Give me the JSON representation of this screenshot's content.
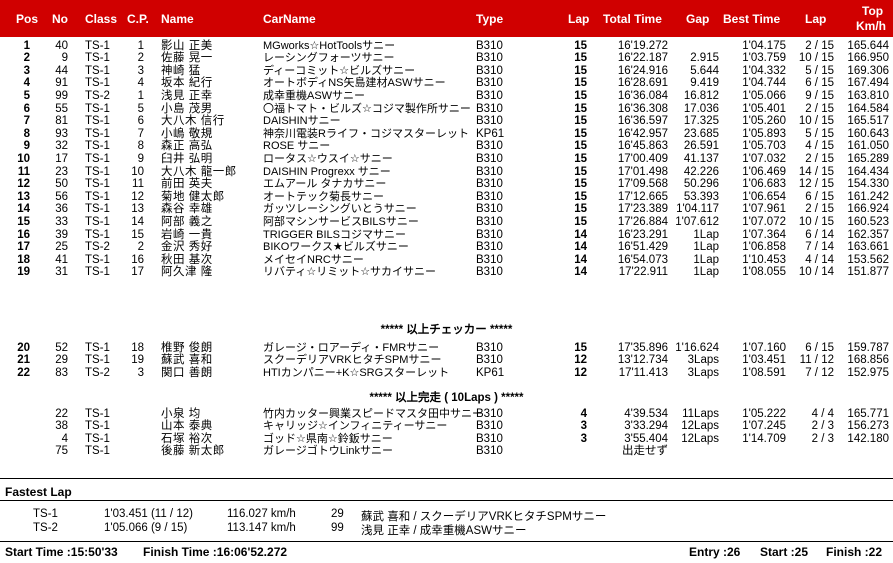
{
  "headers": {
    "pos": "Pos",
    "no": "No",
    "class": "Class",
    "cp": "C.P.",
    "name": "Name",
    "carname": "CarName",
    "type": "Type",
    "lap": "Lap",
    "total": "Total Time",
    "gap": "Gap",
    "best": "Best Time",
    "lap_b": "Lap",
    "top_l1": "Top",
    "top_l2": "Km/h"
  },
  "group1": [
    {
      "pos": "1",
      "no": "40",
      "cls": "TS-1",
      "cp": "1",
      "name": "影山 正美",
      "car": "MGworks☆HotToolsサニー",
      "type": "B310",
      "lap": "15",
      "total": "16'19.272",
      "gap": "",
      "best": "1'04.175",
      "bestlap": "2 / 15",
      "top": "165.644"
    },
    {
      "pos": "2",
      "no": "9",
      "cls": "TS-1",
      "cp": "2",
      "name": "佐藤 晃一",
      "car": "レーシングフォーツサニー",
      "type": "B310",
      "lap": "15",
      "total": "16'22.187",
      "gap": "2.915",
      "best": "1'03.759",
      "bestlap": "10 / 15",
      "top": "166.950"
    },
    {
      "pos": "3",
      "no": "44",
      "cls": "TS-1",
      "cp": "3",
      "name": "神崎 猛",
      "car": "ディーコミット☆ビルズサニー",
      "type": "B310",
      "lap": "15",
      "total": "16'24.916",
      "gap": "5.644",
      "best": "1'04.332",
      "bestlap": "5 / 15",
      "top": "169.306"
    },
    {
      "pos": "4",
      "no": "91",
      "cls": "TS-1",
      "cp": "4",
      "name": "坂本 紀行",
      "car": "オートボディNS矢島建材ASWサニー",
      "type": "B310",
      "lap": "15",
      "total": "16'28.691",
      "gap": "9.419",
      "best": "1'04.744",
      "bestlap": "6 / 15",
      "top": "167.494"
    },
    {
      "pos": "5",
      "no": "99",
      "cls": "TS-2",
      "cp": "1",
      "name": "浅見 正幸",
      "car": "成幸重機ASWサニー",
      "type": "B310",
      "lap": "15",
      "total": "16'36.084",
      "gap": "16.812",
      "best": "1'05.066",
      "bestlap": "9 / 15",
      "top": "163.810"
    },
    {
      "pos": "6",
      "no": "55",
      "cls": "TS-1",
      "cp": "5",
      "name": "小島 茂男",
      "car": "〇福トマト・ビルズ☆コジマ製作所サニー",
      "type": "B310",
      "lap": "15",
      "total": "16'36.308",
      "gap": "17.036",
      "best": "1'05.401",
      "bestlap": "2 / 15",
      "top": "164.584"
    },
    {
      "pos": "7",
      "no": "81",
      "cls": "TS-1",
      "cp": "6",
      "name": "大八木 信行",
      "car": "DAISHINサニー",
      "type": "B310",
      "lap": "15",
      "total": "16'36.597",
      "gap": "17.325",
      "best": "1'05.260",
      "bestlap": "10 / 15",
      "top": "165.517"
    },
    {
      "pos": "8",
      "no": "93",
      "cls": "TS-1",
      "cp": "7",
      "name": "小嶋 敬規",
      "car": "神奈川電装Rライフ・コジマスターレット",
      "type": "KP61",
      "lap": "15",
      "total": "16'42.957",
      "gap": "23.685",
      "best": "1'05.893",
      "bestlap": "5 / 15",
      "top": "160.643"
    },
    {
      "pos": "9",
      "no": "32",
      "cls": "TS-1",
      "cp": "8",
      "name": "森正 高弘",
      "car": "ROSE サニー",
      "type": "B310",
      "lap": "15",
      "total": "16'45.863",
      "gap": "26.591",
      "best": "1'05.703",
      "bestlap": "4 / 15",
      "top": "161.050"
    },
    {
      "pos": "10",
      "no": "17",
      "cls": "TS-1",
      "cp": "9",
      "name": "臼井 弘明",
      "car": "ロータス☆ウスイ☆サニー",
      "type": "B310",
      "lap": "15",
      "total": "17'00.409",
      "gap": "41.137",
      "best": "1'07.032",
      "bestlap": "2 / 15",
      "top": "165.289"
    },
    {
      "pos": "11",
      "no": "23",
      "cls": "TS-1",
      "cp": "10",
      "name": "大八木 龍一郎",
      "car": "DAISHIN Progrexx サニー",
      "type": "B310",
      "lap": "15",
      "total": "17'01.498",
      "gap": "42.226",
      "best": "1'06.469",
      "bestlap": "14 / 15",
      "top": "164.434"
    },
    {
      "pos": "12",
      "no": "50",
      "cls": "TS-1",
      "cp": "11",
      "name": "前田 英夫",
      "car": "エムアール タナカサニー",
      "type": "B310",
      "lap": "15",
      "total": "17'09.568",
      "gap": "50.296",
      "best": "1'06.683",
      "bestlap": "12 / 15",
      "top": "154.330"
    },
    {
      "pos": "13",
      "no": "56",
      "cls": "TS-1",
      "cp": "12",
      "name": "菊地 健太郎",
      "car": "オートテック菊長サニー",
      "type": "B310",
      "lap": "15",
      "total": "17'12.665",
      "gap": "53.393",
      "best": "1'06.654",
      "bestlap": "6 / 15",
      "top": "161.242"
    },
    {
      "pos": "14",
      "no": "36",
      "cls": "TS-1",
      "cp": "13",
      "name": "森谷 幸雄",
      "car": "ガッツレーシングいとうサニー",
      "type": "B310",
      "lap": "15",
      "total": "17'23.389",
      "gap": "1'04.117",
      "best": "1'07.961",
      "bestlap": "2 / 15",
      "top": "166.924"
    },
    {
      "pos": "15",
      "no": "33",
      "cls": "TS-1",
      "cp": "14",
      "name": "阿部 義之",
      "car": "阿部マシンサービスBILSサニー",
      "type": "B310",
      "lap": "15",
      "total": "17'26.884",
      "gap": "1'07.612",
      "best": "1'07.072",
      "bestlap": "10 / 15",
      "top": "160.523"
    },
    {
      "pos": "16",
      "no": "39",
      "cls": "TS-1",
      "cp": "15",
      "name": "岩崎 一貴",
      "car": "TRIGGER BILSコジマサニー",
      "type": "B310",
      "lap": "14",
      "total": "16'23.291",
      "gap": "1Lap",
      "best": "1'07.364",
      "bestlap": "6 / 14",
      "top": "162.357"
    },
    {
      "pos": "17",
      "no": "25",
      "cls": "TS-2",
      "cp": "2",
      "name": "金沢 秀好",
      "car": "BIKOワークス★ビルズサニー",
      "type": "B310",
      "lap": "14",
      "total": "16'51.429",
      "gap": "1Lap",
      "best": "1'06.858",
      "bestlap": "7 / 14",
      "top": "163.661"
    },
    {
      "pos": "18",
      "no": "41",
      "cls": "TS-1",
      "cp": "16",
      "name": "秋田 基次",
      "car": "メイセイNRCサニー",
      "type": "B310",
      "lap": "14",
      "total": "16'54.073",
      "gap": "1Lap",
      "best": "1'10.453",
      "bestlap": "4 / 14",
      "top": "153.562"
    },
    {
      "pos": "19",
      "no": "31",
      "cls": "TS-1",
      "cp": "17",
      "name": "阿久津 隆",
      "car": "リバティ☆リミット☆サカイサニー",
      "type": "B310",
      "lap": "14",
      "total": "17'22.911",
      "gap": "1Lap",
      "best": "1'08.055",
      "bestlap": "10 / 14",
      "top": "151.877"
    }
  ],
  "sep1": "***** 以上チェッカー *****",
  "group2": [
    {
      "pos": "20",
      "no": "52",
      "cls": "TS-1",
      "cp": "18",
      "name": "椎野 俊朗",
      "car": "ガレージ・ロアーディ・FMRサニー",
      "type": "B310",
      "lap": "15",
      "total": "17'35.896",
      "gap": "1'16.624",
      "best": "1'07.160",
      "bestlap": "6 / 15",
      "top": "159.787"
    },
    {
      "pos": "21",
      "no": "29",
      "cls": "TS-1",
      "cp": "19",
      "name": "蘇武 喜和",
      "car": "スクーデリアVRKヒタチSPMサニー",
      "type": "B310",
      "lap": "12",
      "total": "13'12.734",
      "gap": "3Laps",
      "best": "1'03.451",
      "bestlap": "11 / 12",
      "top": "168.856"
    },
    {
      "pos": "22",
      "no": "83",
      "cls": "TS-2",
      "cp": "3",
      "name": "関口 善朗",
      "car": "HTIカンパニー+K☆SRGスターレット",
      "type": "KP61",
      "lap": "12",
      "total": "17'11.413",
      "gap": "3Laps",
      "best": "1'08.591",
      "bestlap": "7 / 12",
      "top": "152.975"
    }
  ],
  "sep2": "***** 以上完走 ( 10Laps ) *****",
  "group3": [
    {
      "pos": "",
      "no": "22",
      "cls": "TS-1",
      "cp": "",
      "name": "小泉 均",
      "car": "竹内カッター興業スピードマスタ田中サニー",
      "type": "B310",
      "lap": "4",
      "total": "4'39.534",
      "gap": "11Laps",
      "best": "1'05.222",
      "bestlap": "4 / 4",
      "top": "165.771"
    },
    {
      "pos": "",
      "no": "38",
      "cls": "TS-1",
      "cp": "",
      "name": "山本 泰典",
      "car": "キャリッジ☆インフィニティーサニー",
      "type": "B310",
      "lap": "3",
      "total": "3'33.294",
      "gap": "12Laps",
      "best": "1'07.245",
      "bestlap": "2 / 3",
      "top": "156.273"
    },
    {
      "pos": "",
      "no": "4",
      "cls": "TS-1",
      "cp": "",
      "name": "石塚 裕次",
      "car": "ゴッド☆県南☆鈴鈑サニー",
      "type": "B310",
      "lap": "3",
      "total": "3'55.404",
      "gap": "12Laps",
      "best": "1'14.709",
      "bestlap": "2 / 3",
      "top": "142.180"
    },
    {
      "pos": "",
      "no": "75",
      "cls": "TS-1",
      "cp": "",
      "name": "後藤 新太郎",
      "car": "ガレージゴトウLinkサニー",
      "type": "B310",
      "lap": "",
      "total": "出走せず",
      "gap": "",
      "best": "",
      "bestlap": "",
      "top": ""
    }
  ],
  "fastest": {
    "title": "Fastest Lap",
    "rows": [
      {
        "cls": "TS-1",
        "time": "1'03.451 (11 / 12)",
        "speed": "116.027 km/h",
        "no": "29",
        "driver": "蘇武 喜和 / スクーデリアVRKヒタチSPMサニー"
      },
      {
        "cls": "TS-2",
        "time": "1'05.066 (9 / 15)",
        "speed": "113.147 km/h",
        "no": "99",
        "driver": "浅見 正幸 / 成幸重機ASWサニー"
      }
    ]
  },
  "footer": {
    "start": "Start Time :15:50'33",
    "finish": "Finish Time :16:06'52.272",
    "entry": "Entry :26",
    "started": "Start :25",
    "finished": "Finish :22"
  },
  "colors": {
    "header_bg": "#d00000",
    "header_text": "#ffffff"
  }
}
